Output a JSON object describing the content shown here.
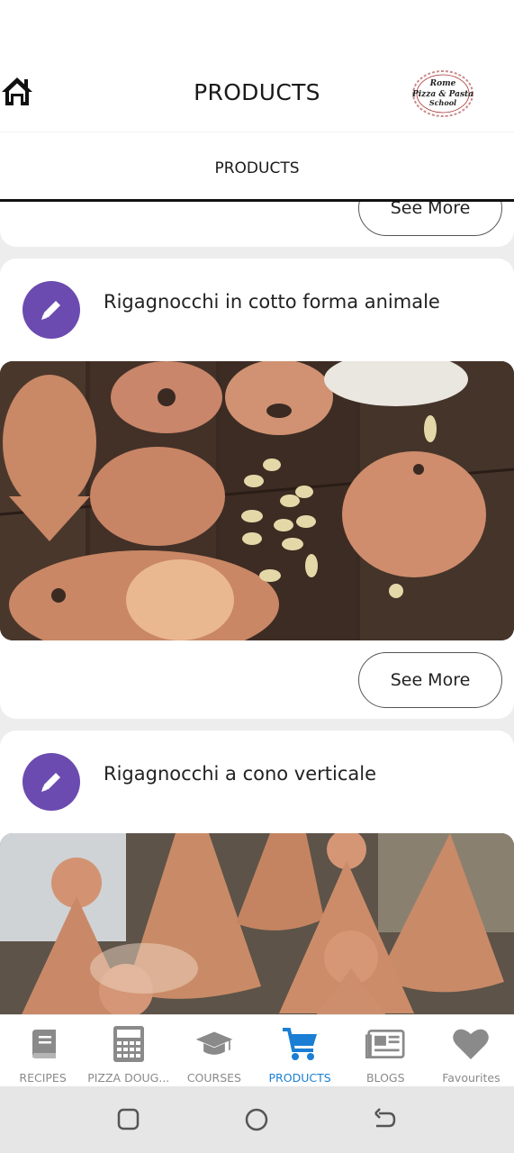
{
  "header": {
    "title": "PRODUCTS",
    "logo_text": [
      "Rome",
      "Pizza & Pasta",
      "School"
    ]
  },
  "tabs": [
    {
      "label": "PRODUCTS"
    }
  ],
  "see_more_label": "See More",
  "products": [
    {
      "title": "Rigagnocchi in cotto forma animale"
    },
    {
      "title": "Rigagnocchi a cono verticale"
    }
  ],
  "nav": [
    {
      "label": "RECIPES",
      "icon": "book-icon"
    },
    {
      "label": "PIZZA DOUG...",
      "icon": "calculator-icon"
    },
    {
      "label": "COURSES",
      "icon": "graduation-cap-icon"
    },
    {
      "label": "PRODUCTS",
      "icon": "cart-icon",
      "active": true
    },
    {
      "label": "BLOGS",
      "icon": "newspaper-icon"
    },
    {
      "label": "Favourites",
      "icon": "heart-icon"
    }
  ],
  "colors": {
    "accent": "#1a7fd4",
    "avatar": "#6b4bb0",
    "nav_inactive": "#8a8a8a"
  }
}
